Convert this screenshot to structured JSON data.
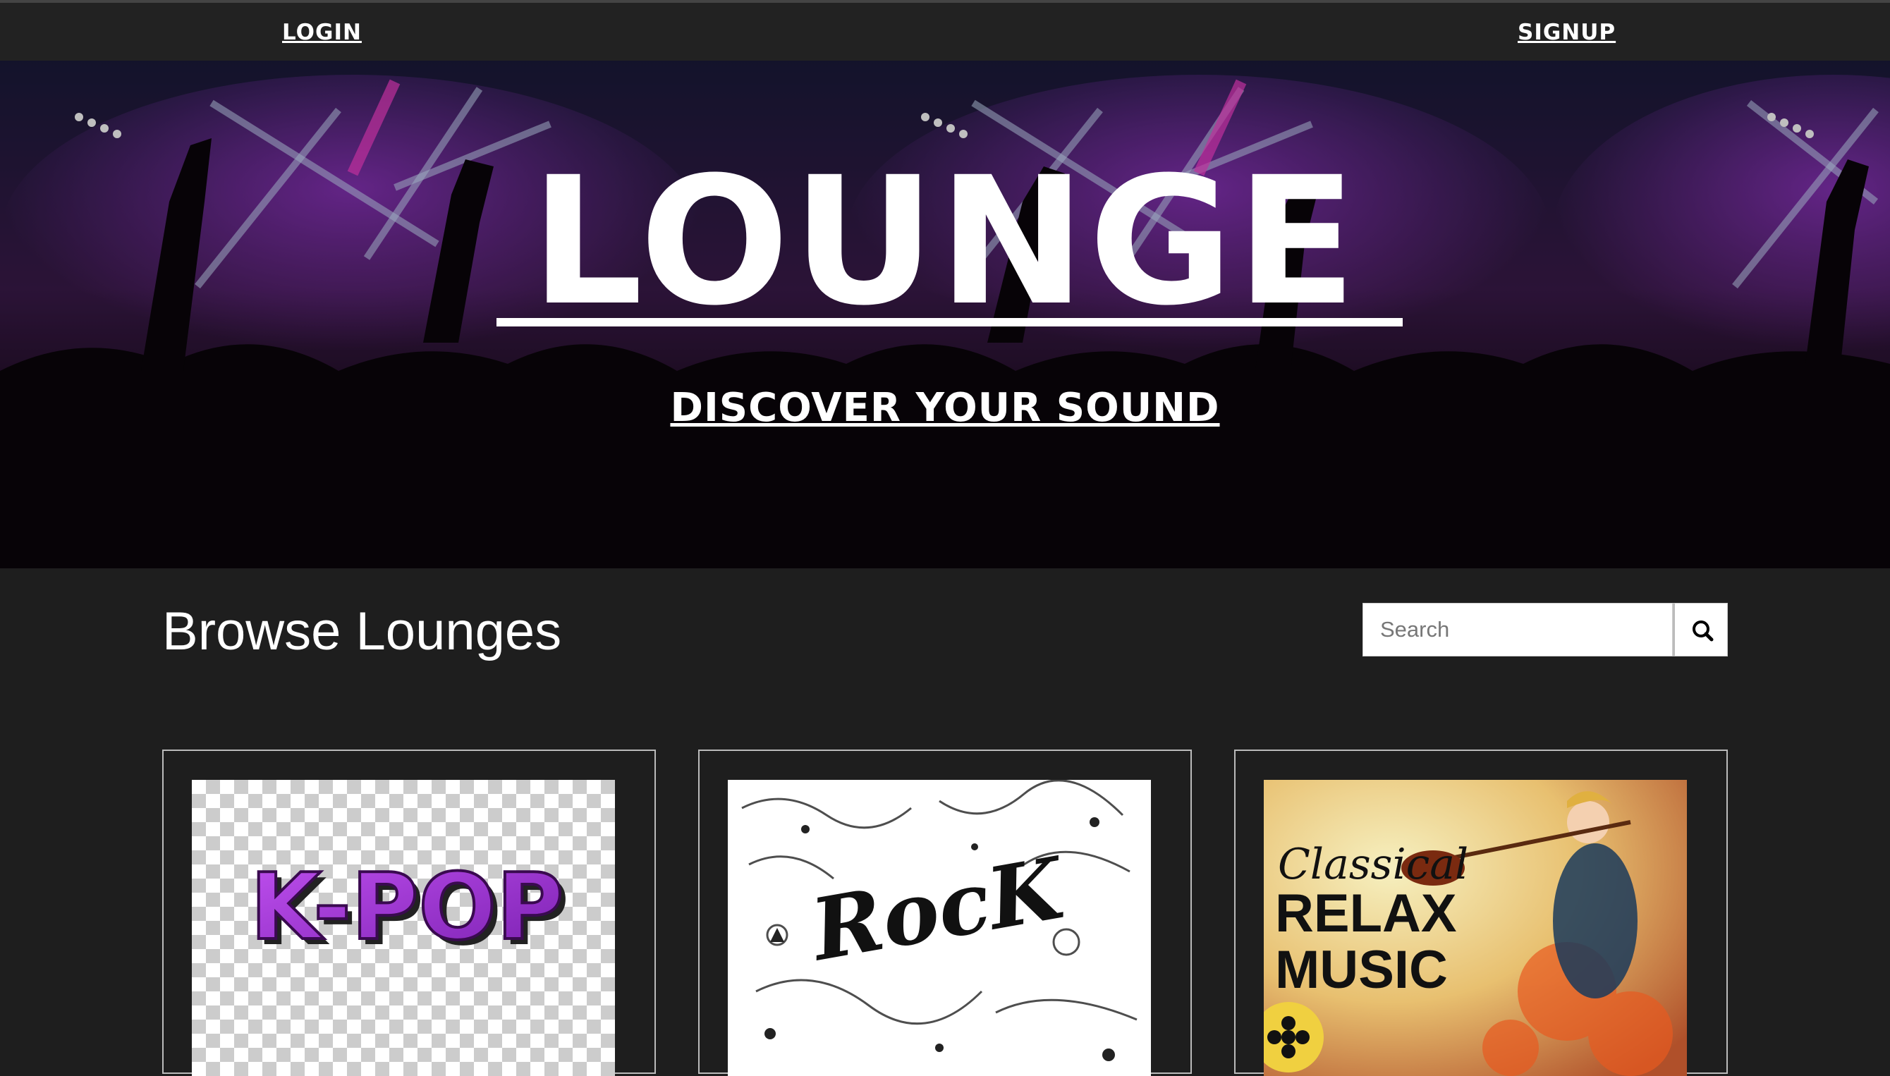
{
  "nav": {
    "login_label": "LOGIN",
    "signup_label": "SIGNUP"
  },
  "hero": {
    "title": "LOUNGE",
    "subtitle": "DISCOVER YOUR SOUND"
  },
  "browse": {
    "heading": "Browse Lounges",
    "search_placeholder": "Search"
  },
  "lounges": [
    {
      "name": "k-pop",
      "image_text": "K-POP",
      "accent": "#9b30d9"
    },
    {
      "name": "rock",
      "image_text": "RocK",
      "accent": "#222222"
    },
    {
      "name": "classical",
      "image_text_script": "Classical",
      "image_text_block": [
        "RELAX",
        "MUSIC"
      ],
      "accent": "#f0c040"
    }
  ]
}
